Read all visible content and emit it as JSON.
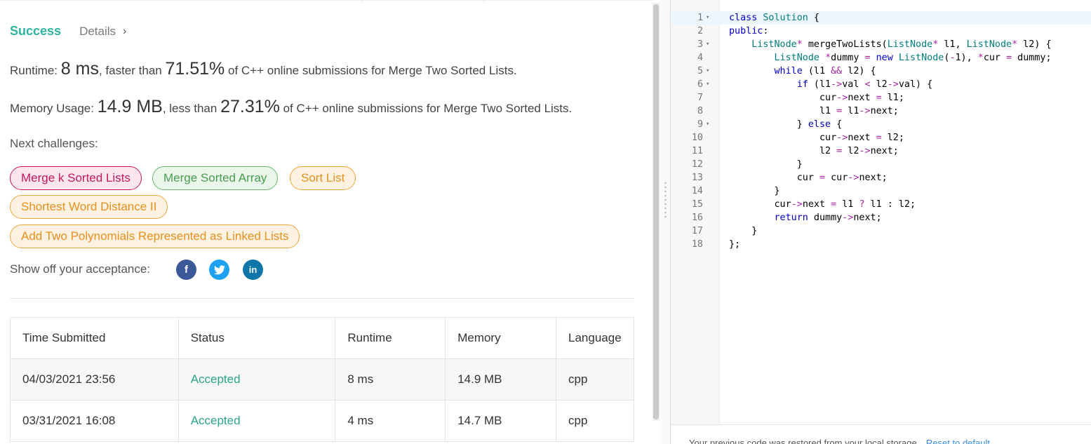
{
  "result": {
    "status": "Success",
    "details_label": "Details",
    "runtime_prefix": "Runtime:",
    "runtime_value": "8 ms",
    "runtime_mid": ", faster than",
    "runtime_percent": "71.51%",
    "runtime_suffix": "of C++ online submissions for Merge Two Sorted Lists.",
    "memory_prefix": "Memory Usage:",
    "memory_value": "14.9 MB",
    "memory_mid": ", less than",
    "memory_percent": "27.31%",
    "memory_suffix": "of C++ online submissions for Merge Two Sorted Lists."
  },
  "challenges": {
    "label": "Next challenges:",
    "items": [
      {
        "label": "Merge k Sorted Lists",
        "difficulty_color": "#c2185b"
      },
      {
        "label": "Merge Sorted Array",
        "difficulty_color": "#4a9d50"
      },
      {
        "label": "Sort List",
        "difficulty_color": "#e8901c"
      },
      {
        "label": "Shortest Word Distance II",
        "difficulty_color": "#e8901c"
      },
      {
        "label": "Add Two Polynomials Represented as Linked Lists",
        "difficulty_color": "#e8901c"
      }
    ]
  },
  "share": {
    "label": "Show off your acceptance:",
    "icons": [
      "facebook-icon",
      "twitter-icon",
      "linkedin-icon"
    ],
    "facebook_glyph": "f",
    "linkedin_glyph": "in"
  },
  "submissions": {
    "headers": [
      "Time Submitted",
      "Status",
      "Runtime",
      "Memory",
      "Language"
    ],
    "rows": [
      {
        "time": "04/03/2021 23:56",
        "status": "Accepted",
        "runtime": "8 ms",
        "memory": "14.9 MB",
        "language": "cpp"
      },
      {
        "time": "03/31/2021 16:08",
        "status": "Accepted",
        "runtime": "4 ms",
        "memory": "14.7 MB",
        "language": "cpp"
      }
    ]
  },
  "editor": {
    "line_numbers": [
      "1",
      "2",
      "3",
      "4",
      "5",
      "6",
      "7",
      "8",
      "9",
      "10",
      "11",
      "12",
      "13",
      "14",
      "15",
      "16",
      "17",
      "18"
    ],
    "fold_marker": "▾",
    "code_lines": [
      "class Solution {",
      "public:",
      "    ListNode* mergeTwoLists(ListNode* l1, ListNode* l2) {",
      "        ListNode *dummy = new ListNode(-1), *cur = dummy;",
      "        while (l1 && l2) {",
      "            if (l1->val < l2->val) {",
      "                cur->next = l1;",
      "                l1 = l1->next;",
      "            } else {",
      "                cur->next = l2;",
      "                l2 = l2->next;",
      "            }",
      "            cur = cur->next;",
      "        }",
      "        cur->next = l1 ? l1 : l2;",
      "        return dummy->next;",
      "    }",
      "};"
    ],
    "restore_message": "Your previous code was restored from your local storage.",
    "reset_label": "Reset to default"
  }
}
